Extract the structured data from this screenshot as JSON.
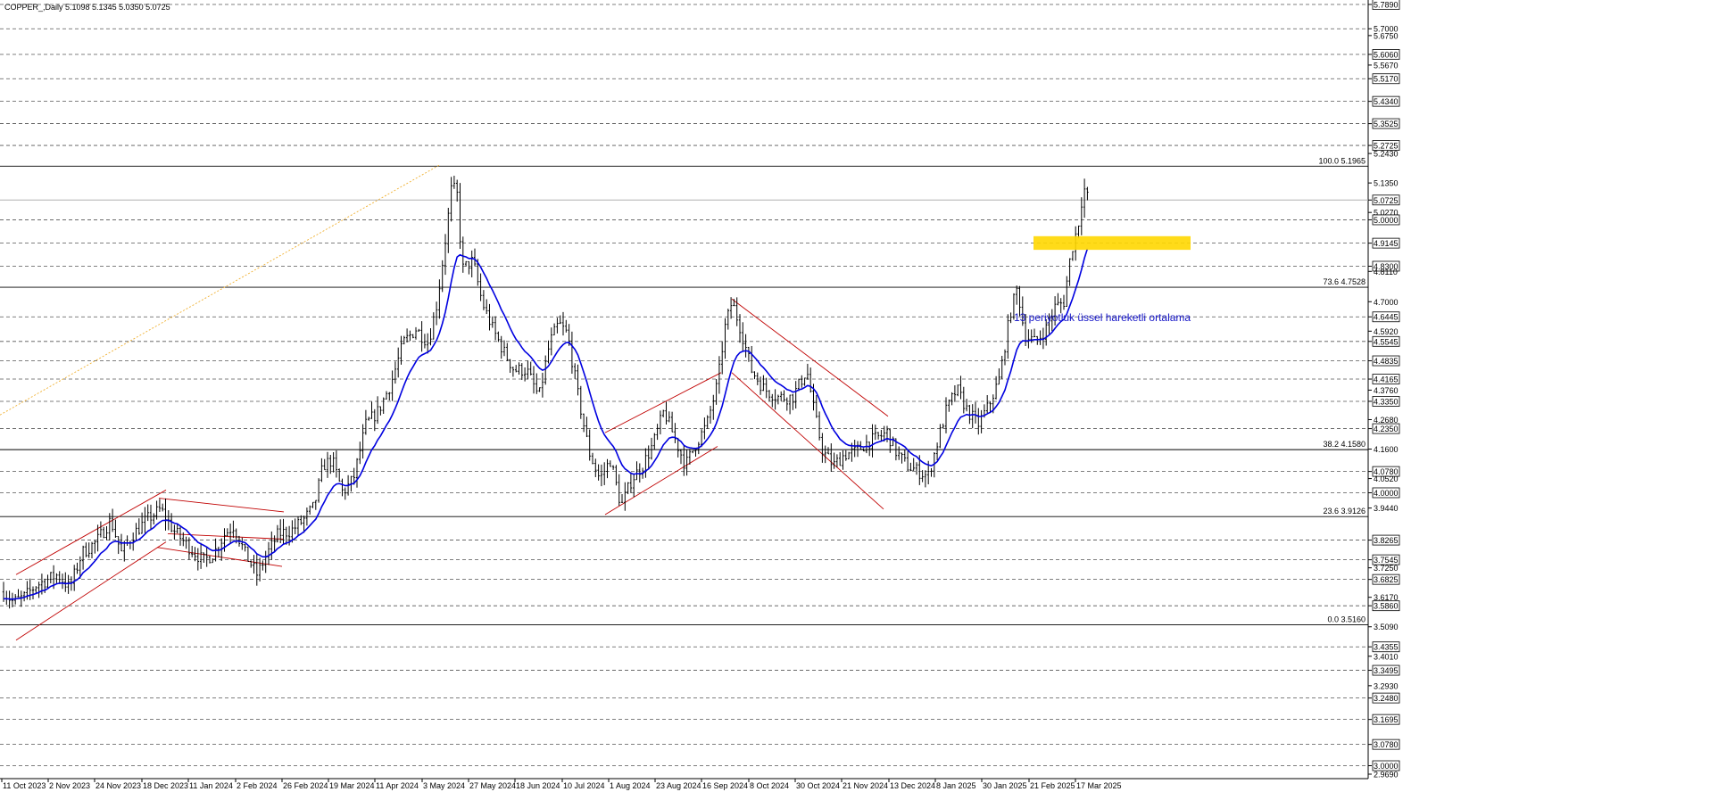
{
  "chart_data": {
    "type": "candlestick",
    "title": "COPPER_,Daily  5.1098 5.1345 5.0350 5.0725",
    "symbol": "COPPER_",
    "timeframe": "Daily",
    "ohlc_last": {
      "open": 5.1098,
      "high": 5.1345,
      "low": 5.035,
      "close": 5.0725
    },
    "current_price": 5.0725,
    "ylim": [
      2.969,
      5.789
    ],
    "y_ticks": [
      {
        "label": "5.7890",
        "value": 5.789,
        "boxed": true
      },
      {
        "label": "5.7000",
        "value": 5.7,
        "boxed": false
      },
      {
        "label": "5.6750",
        "value": 5.675,
        "boxed": false
      },
      {
        "label": "5.6060",
        "value": 5.606,
        "boxed": true
      },
      {
        "label": "5.5670",
        "value": 5.567,
        "boxed": false
      },
      {
        "label": "5.5170",
        "value": 5.517,
        "boxed": true
      },
      {
        "label": "5.4340",
        "value": 5.434,
        "boxed": true
      },
      {
        "label": "5.3525",
        "value": 5.3525,
        "boxed": true
      },
      {
        "label": "5.2725",
        "value": 5.2725,
        "boxed": true
      },
      {
        "label": "5.2430",
        "value": 5.243,
        "boxed": false
      },
      {
        "label": "5.1350",
        "value": 5.135,
        "boxed": false
      },
      {
        "label": "5.0725",
        "value": 5.0725,
        "boxed": true
      },
      {
        "label": "5.0270",
        "value": 5.027,
        "boxed": false
      },
      {
        "label": "5.0000",
        "value": 5.0,
        "boxed": true
      },
      {
        "label": "4.9145",
        "value": 4.9145,
        "boxed": true
      },
      {
        "label": "4.8300",
        "value": 4.83,
        "boxed": true
      },
      {
        "label": "4.8110",
        "value": 4.811,
        "boxed": false
      },
      {
        "label": "4.7000",
        "value": 4.7,
        "boxed": false
      },
      {
        "label": "4.6445",
        "value": 4.6445,
        "boxed": true
      },
      {
        "label": "4.5920",
        "value": 4.592,
        "boxed": false
      },
      {
        "label": "4.5545",
        "value": 4.5545,
        "boxed": true
      },
      {
        "label": "4.4835",
        "value": 4.4835,
        "boxed": true
      },
      {
        "label": "4.4165",
        "value": 4.4165,
        "boxed": true
      },
      {
        "label": "4.3760",
        "value": 4.376,
        "boxed": false
      },
      {
        "label": "4.3350",
        "value": 4.335,
        "boxed": true
      },
      {
        "label": "4.2680",
        "value": 4.268,
        "boxed": false
      },
      {
        "label": "4.2350",
        "value": 4.235,
        "boxed": true
      },
      {
        "label": "4.1600",
        "value": 4.16,
        "boxed": false
      },
      {
        "label": "4.0780",
        "value": 4.078,
        "boxed": true
      },
      {
        "label": "4.0520",
        "value": 4.052,
        "boxed": false
      },
      {
        "label": "4.0000",
        "value": 4.0,
        "boxed": true
      },
      {
        "label": "3.9440",
        "value": 3.944,
        "boxed": false
      },
      {
        "label": "3.8265",
        "value": 3.8265,
        "boxed": true
      },
      {
        "label": "3.7545",
        "value": 3.7545,
        "boxed": true
      },
      {
        "label": "3.7250",
        "value": 3.725,
        "boxed": false
      },
      {
        "label": "3.6825",
        "value": 3.6825,
        "boxed": true
      },
      {
        "label": "3.6170",
        "value": 3.617,
        "boxed": false
      },
      {
        "label": "3.5860",
        "value": 3.586,
        "boxed": true
      },
      {
        "label": "3.5090",
        "value": 3.509,
        "boxed": false
      },
      {
        "label": "3.4355",
        "value": 3.4355,
        "boxed": true
      },
      {
        "label": "3.4010",
        "value": 3.401,
        "boxed": false
      },
      {
        "label": "3.3495",
        "value": 3.3495,
        "boxed": true
      },
      {
        "label": "3.2930",
        "value": 3.293,
        "boxed": false
      },
      {
        "label": "3.2480",
        "value": 3.248,
        "boxed": true
      },
      {
        "label": "3.1695",
        "value": 3.1695,
        "boxed": true
      },
      {
        "label": "3.0780",
        "value": 3.078,
        "boxed": true
      },
      {
        "label": "3.0000",
        "value": 3.0,
        "boxed": true
      },
      {
        "label": "2.9690",
        "value": 2.969,
        "boxed": false
      }
    ],
    "dashed_levels": [
      5.789,
      5.7,
      5.606,
      5.517,
      5.434,
      5.3525,
      5.2725,
      5.0,
      4.9145,
      4.83,
      4.6445,
      4.5545,
      4.4835,
      4.4165,
      4.335,
      4.235,
      4.078,
      4.0,
      3.8265,
      3.7545,
      3.6825,
      3.586,
      3.4355,
      3.3495,
      3.248,
      3.1695,
      3.078,
      3.0
    ],
    "x_labels": [
      "11 Oct 2023",
      "2 Nov 2023",
      "24 Nov 2023",
      "18 Dec 2023",
      "11 Jan 2024",
      "2 Feb 2024",
      "26 Feb 2024",
      "19 Mar 2024",
      "11 Apr 2024",
      "3 May 2024",
      "27 May 2024",
      "18 Jun 2024",
      "10 Jul 2024",
      "1 Aug 2024",
      "23 Aug 2024",
      "16 Sep 2024",
      "8 Oct 2024",
      "30 Oct 2024",
      "21 Nov 2024",
      "13 Dec 2024",
      "8 Jan 2025",
      "30 Jan 2025",
      "21 Feb 2025",
      "17 Mar 2025"
    ],
    "fibonacci": [
      {
        "label": "100.0 5.1965",
        "value": 5.1965
      },
      {
        "label": "73.6 4.7528",
        "value": 4.7528
      },
      {
        "label": "38.2 4.1580",
        "value": 4.158
      },
      {
        "label": "23.6 3.9126",
        "value": 3.9126
      },
      {
        "label": "0.0 3.5160",
        "value": 3.516
      }
    ],
    "price_path": [
      [
        0,
        3.65
      ],
      [
        15,
        3.6
      ],
      [
        28,
        3.62
      ],
      [
        40,
        3.66
      ],
      [
        52,
        3.68
      ],
      [
        65,
        3.7
      ],
      [
        78,
        3.65
      ],
      [
        92,
        3.78
      ],
      [
        108,
        3.82
      ],
      [
        124,
        3.9
      ],
      [
        136,
        3.78
      ],
      [
        150,
        3.85
      ],
      [
        164,
        3.9
      ],
      [
        180,
        3.94
      ],
      [
        195,
        3.86
      ],
      [
        212,
        3.8
      ],
      [
        228,
        3.75
      ],
      [
        240,
        3.78
      ],
      [
        252,
        3.85
      ],
      [
        262,
        3.88
      ],
      [
        274,
        3.78
      ],
      [
        288,
        3.7
      ],
      [
        300,
        3.78
      ],
      [
        312,
        3.85
      ],
      [
        326,
        3.86
      ],
      [
        340,
        3.9
      ],
      [
        352,
        3.95
      ],
      [
        362,
        4.1
      ],
      [
        372,
        4.12
      ],
      [
        384,
        4.0
      ],
      [
        396,
        4.05
      ],
      [
        410,
        4.25
      ],
      [
        424,
        4.3
      ],
      [
        438,
        4.4
      ],
      [
        452,
        4.55
      ],
      [
        466,
        4.6
      ],
      [
        480,
        4.55
      ],
      [
        490,
        4.7
      ],
      [
        500,
        4.95
      ],
      [
        506,
        5.12
      ],
      [
        512,
        5.1
      ],
      [
        518,
        4.82
      ],
      [
        530,
        4.85
      ],
      [
        540,
        4.7
      ],
      [
        552,
        4.6
      ],
      [
        564,
        4.52
      ],
      [
        576,
        4.45
      ],
      [
        590,
        4.45
      ],
      [
        604,
        4.35
      ],
      [
        616,
        4.55
      ],
      [
        626,
        4.62
      ],
      [
        636,
        4.58
      ],
      [
        648,
        4.35
      ],
      [
        660,
        4.15
      ],
      [
        672,
        4.05
      ],
      [
        684,
        4.12
      ],
      [
        696,
        3.95
      ],
      [
        708,
        4.05
      ],
      [
        720,
        4.1
      ],
      [
        732,
        4.18
      ],
      [
        744,
        4.3
      ],
      [
        756,
        4.2
      ],
      [
        768,
        4.1
      ],
      [
        780,
        4.18
      ],
      [
        792,
        4.25
      ],
      [
        804,
        4.4
      ],
      [
        812,
        4.6
      ],
      [
        820,
        4.7
      ],
      [
        830,
        4.6
      ],
      [
        842,
        4.45
      ],
      [
        856,
        4.38
      ],
      [
        872,
        4.35
      ],
      [
        888,
        4.35
      ],
      [
        904,
        4.45
      ],
      [
        912,
        4.3
      ],
      [
        922,
        4.15
      ],
      [
        934,
        4.1
      ],
      [
        946,
        4.14
      ],
      [
        958,
        4.15
      ],
      [
        970,
        4.18
      ],
      [
        982,
        4.2
      ],
      [
        994,
        4.22
      ],
      [
        1004,
        4.15
      ],
      [
        1016,
        4.1
      ],
      [
        1028,
        4.08
      ],
      [
        1040,
        4.06
      ],
      [
        1050,
        4.18
      ],
      [
        1060,
        4.3
      ],
      [
        1072,
        4.38
      ],
      [
        1084,
        4.3
      ],
      [
        1096,
        4.25
      ],
      [
        1108,
        4.32
      ],
      [
        1120,
        4.42
      ],
      [
        1132,
        4.66
      ],
      [
        1140,
        4.75
      ],
      [
        1148,
        4.58
      ],
      [
        1160,
        4.55
      ],
      [
        1172,
        4.6
      ],
      [
        1182,
        4.68
      ],
      [
        1192,
        4.7
      ],
      [
        1200,
        4.88
      ],
      [
        1208,
        4.98
      ],
      [
        1214,
        5.12
      ],
      [
        1220,
        5.07
      ]
    ],
    "ema": {
      "label": "13 periyotluk üssel hareketli ortalama",
      "period": 13
    },
    "highlight_zone": {
      "from": 4.89,
      "to": 4.94
    }
  }
}
